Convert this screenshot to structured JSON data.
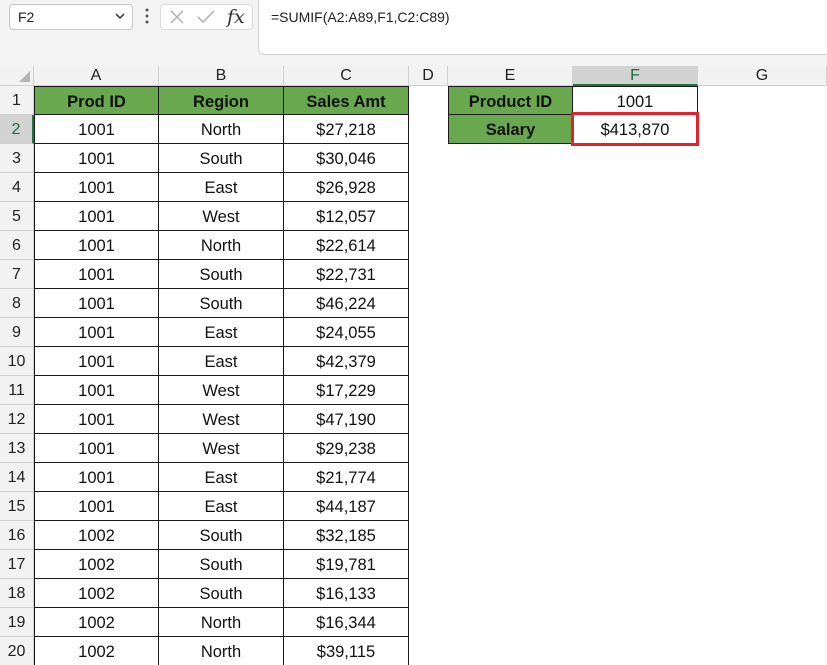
{
  "formula_bar": {
    "name_box": "F2",
    "formula": "=SUMIF(A2:A89,F1,C2:C89)",
    "fx_label": "fx"
  },
  "columns": [
    "A",
    "B",
    "C",
    "D",
    "E",
    "F",
    "G"
  ],
  "rows": [
    "1",
    "2",
    "3",
    "4",
    "5",
    "6",
    "7",
    "8",
    "9",
    "10",
    "11",
    "12",
    "13",
    "14",
    "15",
    "16",
    "17",
    "18",
    "19",
    "20"
  ],
  "table": {
    "headers": [
      "Prod ID",
      "Region",
      "Sales Amt"
    ],
    "rows": [
      [
        "1001",
        "North",
        "$27,218"
      ],
      [
        "1001",
        "South",
        "$30,046"
      ],
      [
        "1001",
        "East",
        "$26,928"
      ],
      [
        "1001",
        "West",
        "$12,057"
      ],
      [
        "1001",
        "North",
        "$22,614"
      ],
      [
        "1001",
        "South",
        "$22,731"
      ],
      [
        "1001",
        "South",
        "$46,224"
      ],
      [
        "1001",
        "East",
        "$24,055"
      ],
      [
        "1001",
        "East",
        "$42,379"
      ],
      [
        "1001",
        "West",
        "$17,229"
      ],
      [
        "1001",
        "West",
        "$47,190"
      ],
      [
        "1001",
        "West",
        "$29,238"
      ],
      [
        "1001",
        "East",
        "$21,774"
      ],
      [
        "1001",
        "East",
        "$44,187"
      ],
      [
        "1002",
        "South",
        "$32,185"
      ],
      [
        "1002",
        "South",
        "$19,781"
      ],
      [
        "1002",
        "South",
        "$16,133"
      ],
      [
        "1002",
        "North",
        "$16,344"
      ],
      [
        "1002",
        "North",
        "$39,115"
      ]
    ]
  },
  "lookup": {
    "product_label": "Product ID",
    "product_value": "1001",
    "salary_label": "Salary",
    "salary_value": "$413,870"
  },
  "colors": {
    "header_green": "#6aa84f",
    "highlight_red": "#e0242c",
    "selected_header_green": "#217346"
  }
}
